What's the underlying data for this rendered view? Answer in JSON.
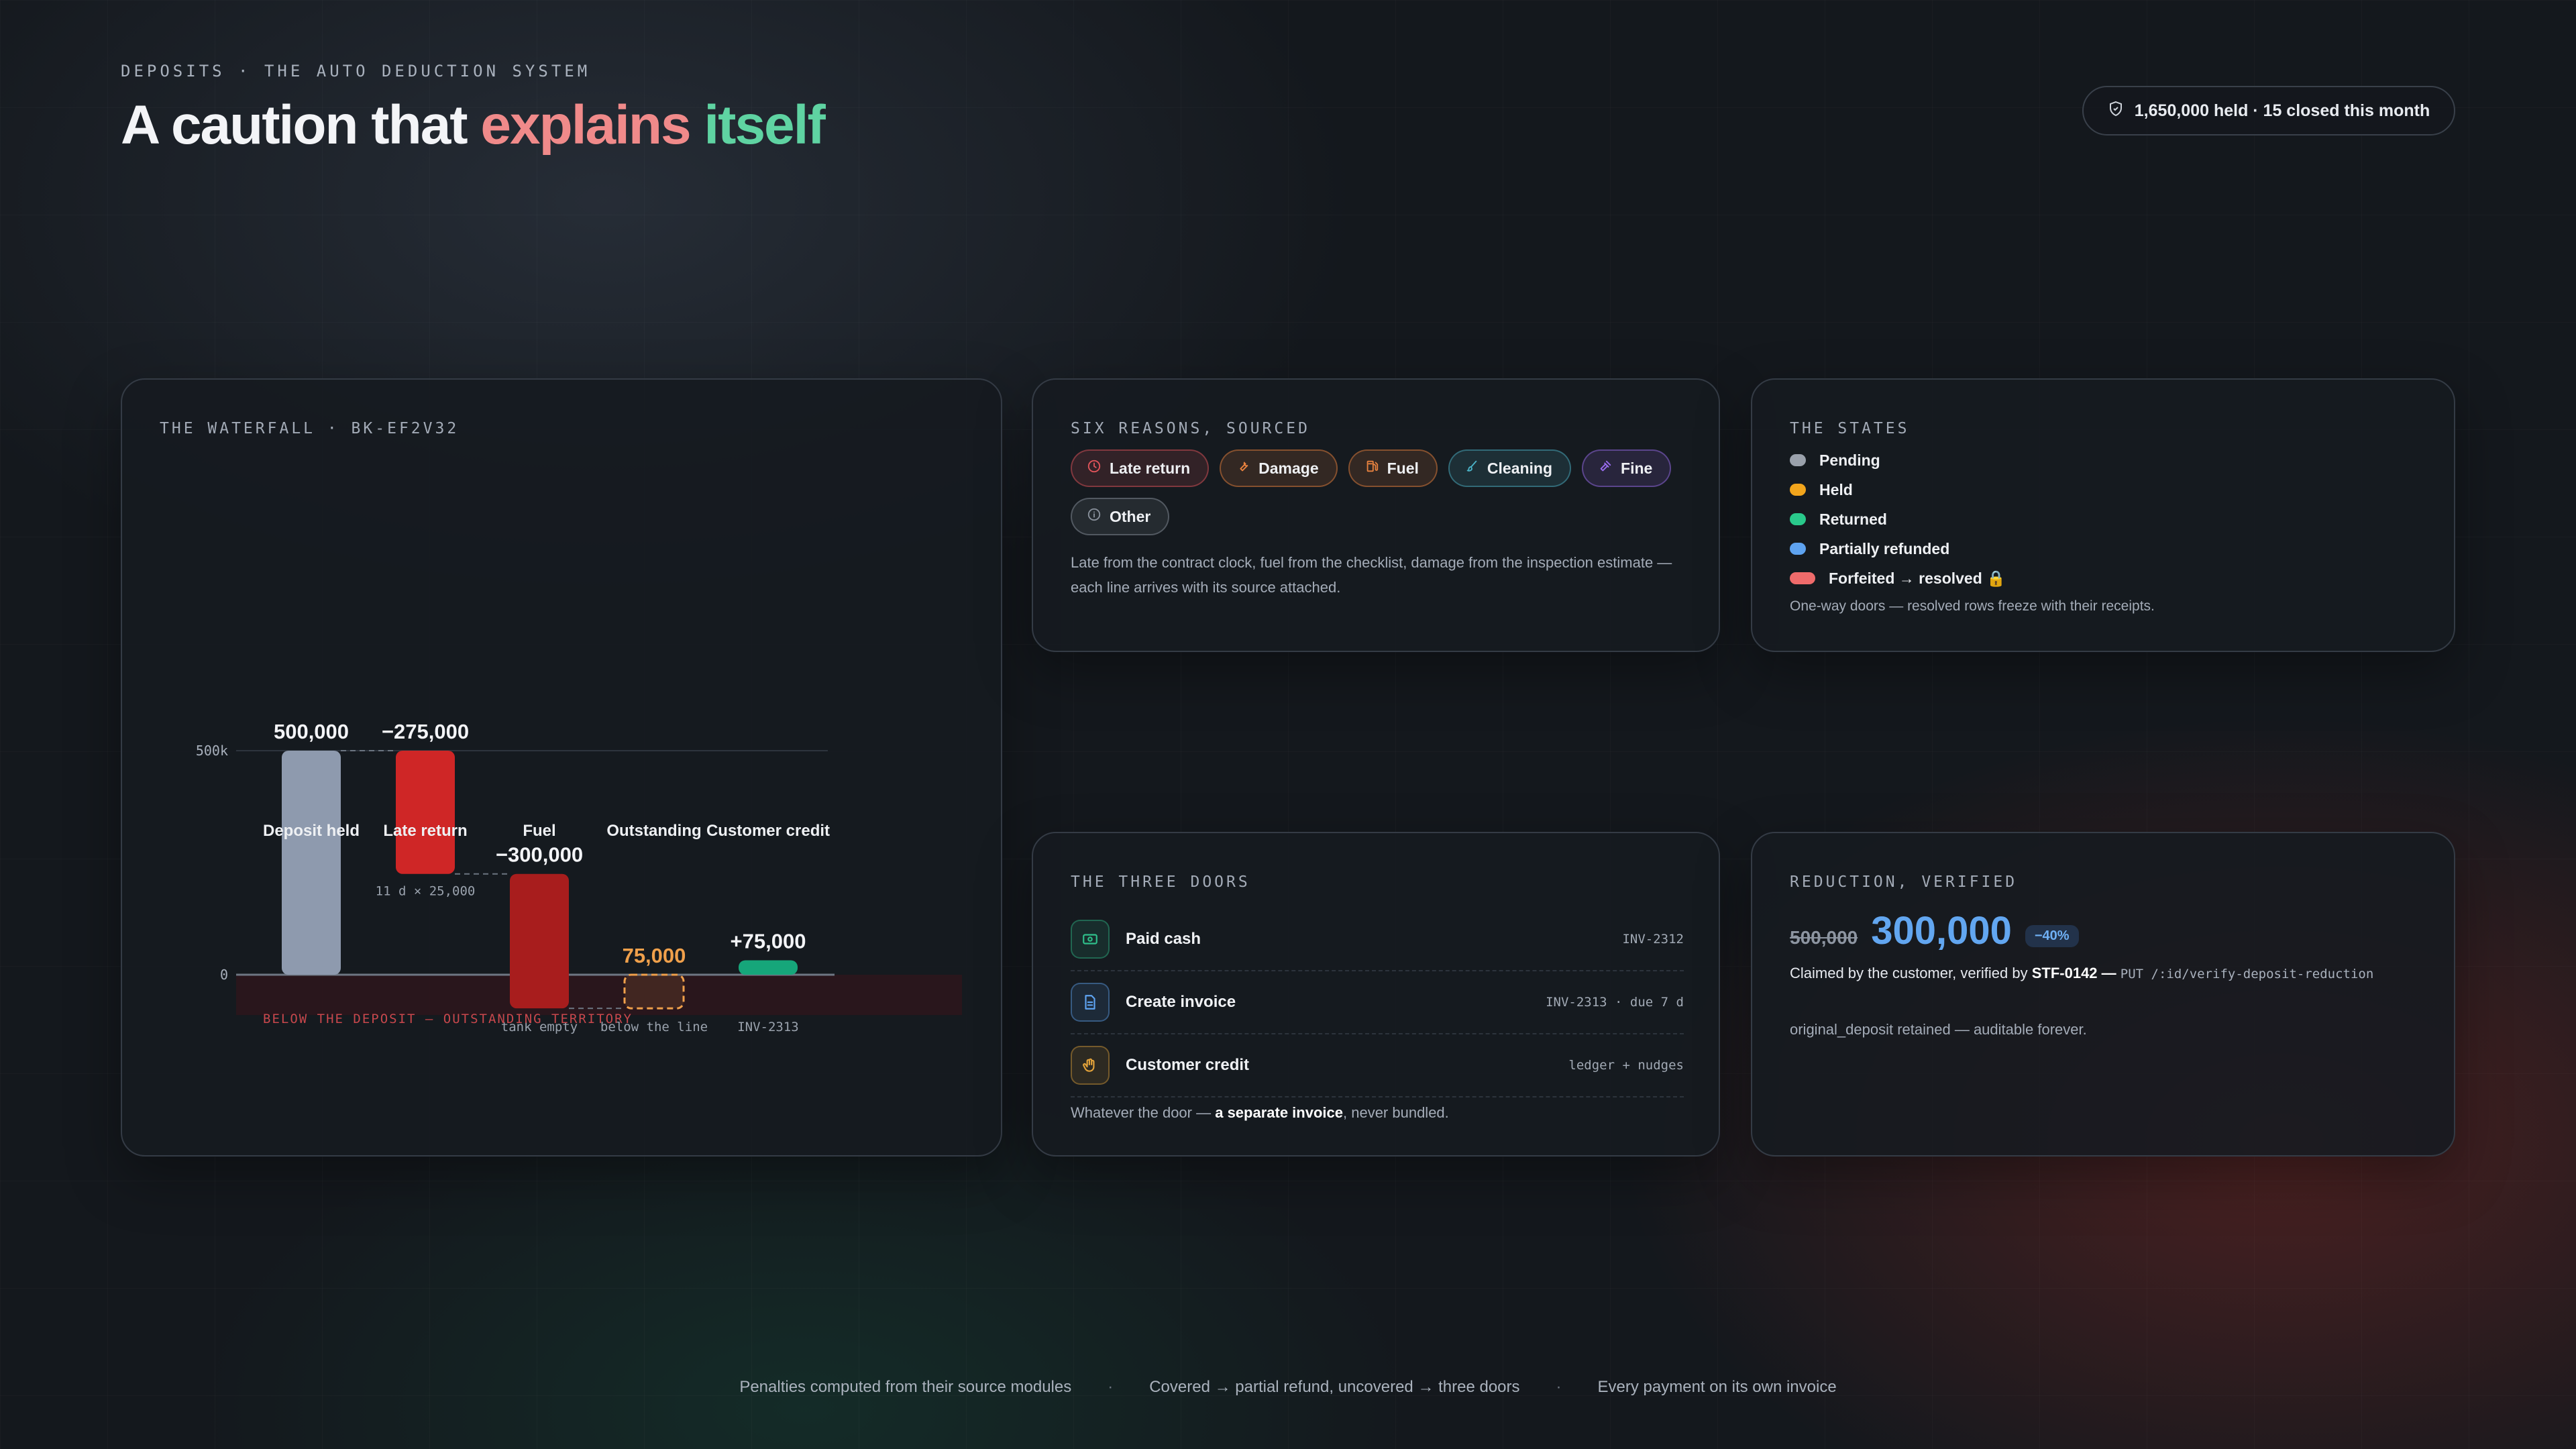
{
  "header": {
    "eyebrow": "DEPOSITS · THE AUTO DEDUCTION SYSTEM",
    "title_part1": "A caution that ",
    "title_part2": "explains",
    "title_part3": " itself",
    "summary_pill": "1,650,000 held · 15 closed this month"
  },
  "waterfall": {
    "title": "THE WATERFALL · BK-EF2V32",
    "axis_tick_top": "500k",
    "axis_tick_zero": "0",
    "below_zone_label": "BELOW THE DEPOSIT — OUTSTANDING TERRITORY",
    "chart_data": {
      "type": "bar",
      "subtype": "waterfall",
      "categories": [
        "Deposit held",
        "Late return",
        "Fuel",
        "Outstanding",
        "Customer credit"
      ],
      "values": [
        500000,
        -275000,
        -300000,
        75000,
        75000
      ],
      "value_labels": [
        "500,000",
        "−275,000",
        "−300,000",
        "75,000",
        "+75,000"
      ],
      "bar_notes": [
        "",
        "11 d × 25,000",
        "tank empty",
        "below the line",
        "INV-2313"
      ],
      "colors": [
        "#8e9aae",
        "#cf2626",
        "#a81d1d",
        "#f0a04b",
        "#16a67a"
      ],
      "ylim": [
        -75000,
        500000
      ],
      "yticks": [
        "500k",
        "0"
      ],
      "grid": false
    }
  },
  "reasons": {
    "title": "SIX REASONS, SOURCED",
    "chips": [
      {
        "label": "Late return",
        "icon": "clock-icon",
        "color": "#e2545a"
      },
      {
        "label": "Damage",
        "icon": "wrench-icon",
        "color": "#e8823f"
      },
      {
        "label": "Fuel",
        "icon": "fuel-icon",
        "color": "#e8823f"
      },
      {
        "label": "Cleaning",
        "icon": "brush-icon",
        "color": "#4bb3c8"
      },
      {
        "label": "Fine",
        "icon": "gavel-icon",
        "color": "#9a6cf0"
      },
      {
        "label": "Other",
        "icon": "circle-info-icon",
        "color": "#8a929d"
      }
    ],
    "text": "Late from the contract clock, fuel from the checklist, damage from the inspection estimate — each line arrives with its source attached."
  },
  "states": {
    "title": "THE STATES",
    "items": [
      {
        "label": "Pending",
        "color": "#9aa1ab"
      },
      {
        "label": "Held",
        "color": "#f2a51c"
      },
      {
        "label": "Returned",
        "color": "#29c98b"
      },
      {
        "label": "Partially refunded",
        "color": "#5ea3f0"
      },
      {
        "label": "Forfeited → resolved 🔒",
        "color": "#ef6b6b"
      }
    ],
    "note": "One-way doors — resolved rows freeze with their receipts."
  },
  "doors": {
    "title": "THE THREE DOORS",
    "items": [
      {
        "label": "Paid cash",
        "meta": "INV-2312",
        "icon": "cash-icon",
        "color": "#2fbf8a"
      },
      {
        "label": "Create invoice",
        "meta": "INV-2313 · due 7 d",
        "icon": "document-icon",
        "color": "#5ea3f0"
      },
      {
        "label": "Customer credit",
        "meta": "ledger + nudges",
        "icon": "hand-icon",
        "color": "#e2a23a"
      }
    ],
    "note_pre": "Whatever the door — ",
    "note_bold": "a separate invoice",
    "note_post": ", never bundled."
  },
  "reduction": {
    "title": "REDUCTION, VERIFIED",
    "old_value": "500,000",
    "new_value": "300,000",
    "percent": "−40%",
    "claim_pre": "Claimed by the customer, verified by ",
    "claim_staff": "STF-0142",
    "claim_dash": " — ",
    "claim_endpoint": "PUT /:id/verify-deposit-reduction",
    "retained": "original_deposit retained — auditable forever."
  },
  "footer": {
    "items": [
      "Penalties computed from their source modules",
      "Covered → partial refund, uncovered → three doors",
      "Every payment on its own invoice"
    ],
    "separator": "·"
  }
}
